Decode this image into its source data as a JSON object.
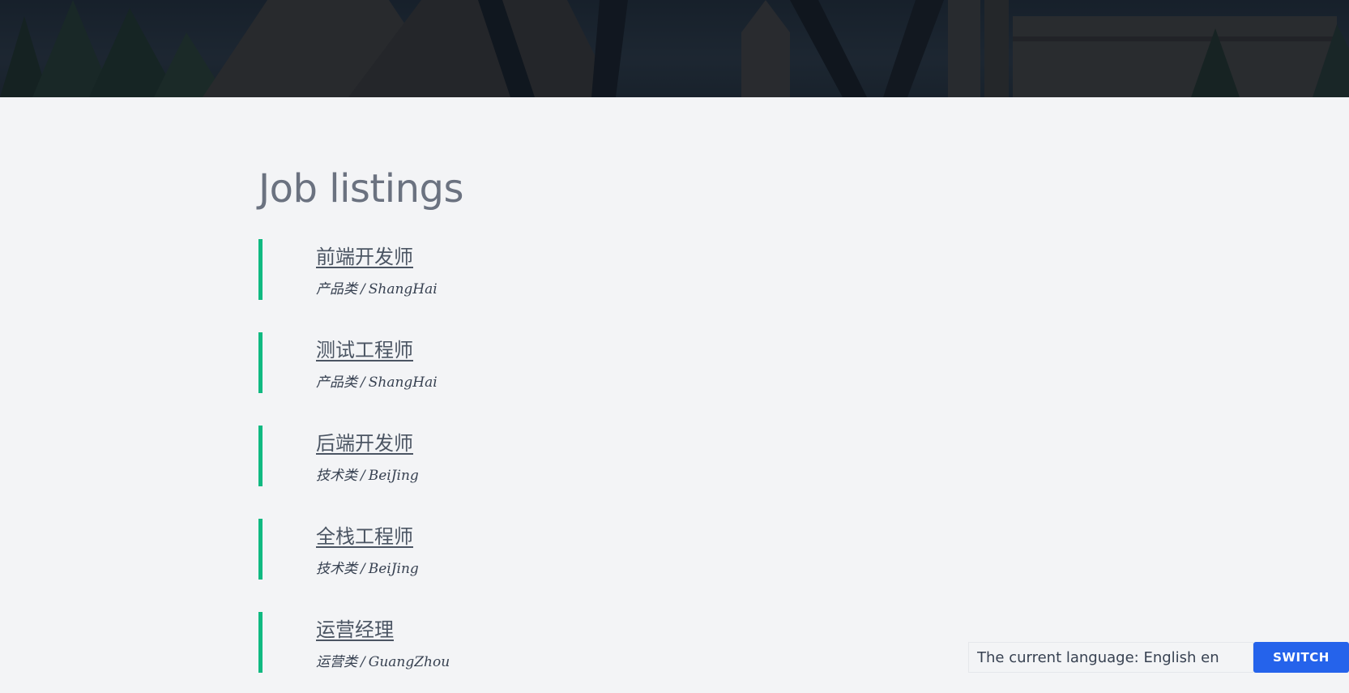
{
  "page": {
    "heading": "Job listings"
  },
  "jobs": [
    {
      "title": "前端开发师",
      "category": "产品类",
      "location": "ShangHai"
    },
    {
      "title": "测试工程师",
      "category": "产品类",
      "location": "ShangHai"
    },
    {
      "title": "后端开发师",
      "category": "技术类",
      "location": "BeiJing"
    },
    {
      "title": "全栈工程师",
      "category": "技术类",
      "location": "BeiJing"
    },
    {
      "title": "运营经理",
      "category": "运营类",
      "location": "GuangZhou"
    }
  ],
  "language": {
    "current_value": "The current language: English en",
    "switch_label": "SWITCH"
  },
  "colors": {
    "accent_bar": "#10b981",
    "switch_button": "#2563eb",
    "background": "#f3f4f6"
  }
}
